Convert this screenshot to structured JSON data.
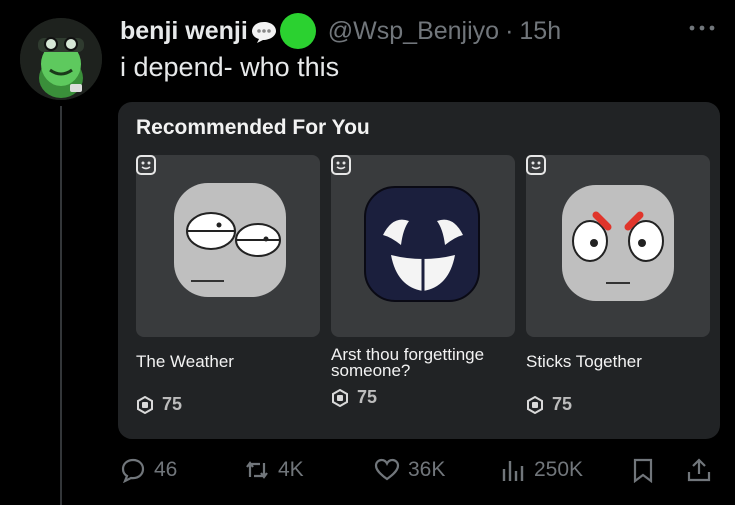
{
  "tweet": {
    "display_name": "benji wenji",
    "handle": "@Wsp_Benjiyo",
    "separator": "·",
    "time": "15h",
    "text": "i depend- who this"
  },
  "card": {
    "title": "Recommended For You",
    "items": [
      {
        "name": "The Weather",
        "price": "75",
        "icon": "sleepy-eyes-face"
      },
      {
        "name": "Arst thou forgettinge someone?",
        "price": "75",
        "icon": "ghost-grin-face"
      },
      {
        "name": "Sticks Together",
        "price": "75",
        "icon": "angry-brows-face"
      }
    ]
  },
  "actions": {
    "replies": "46",
    "reposts": "4K",
    "likes": "36K",
    "views": "250K"
  },
  "colors": {
    "background": "#000000",
    "card": "#212325",
    "muted": "#71767b",
    "verified_dot": "#2bd130"
  }
}
